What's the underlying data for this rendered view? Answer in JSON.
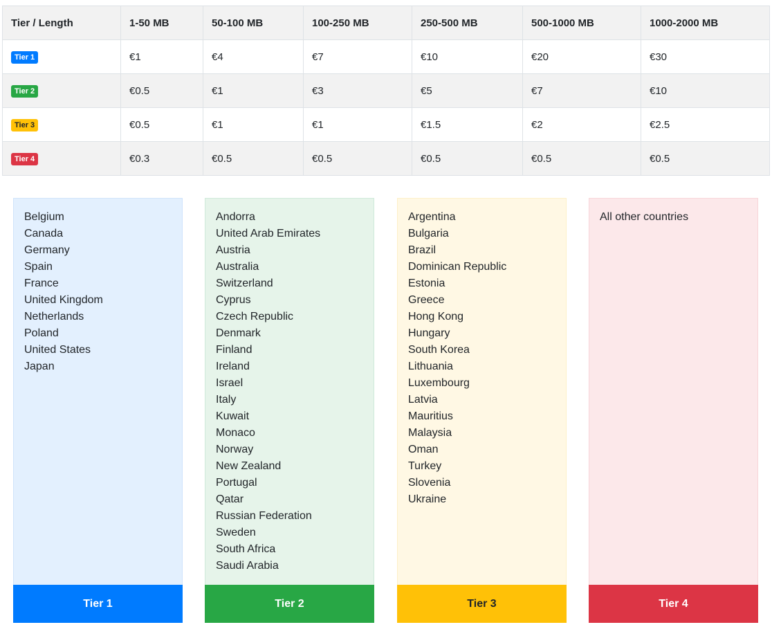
{
  "price_table": {
    "headers": [
      "Tier / Length",
      "1-50 MB",
      "50-100 MB",
      "100-250 MB",
      "250-500 MB",
      "500-1000 MB",
      "1000-2000 MB"
    ],
    "rows": [
      {
        "tier": "Tier 1",
        "prices": [
          "€1",
          "€4",
          "€7",
          "€10",
          "€20",
          "€30"
        ]
      },
      {
        "tier": "Tier 2",
        "prices": [
          "€0.5",
          "€1",
          "€3",
          "€5",
          "€7",
          "€10"
        ]
      },
      {
        "tier": "Tier 3",
        "prices": [
          "€0.5",
          "€1",
          "€1",
          "€1.5",
          "€2",
          "€2.5"
        ]
      },
      {
        "tier": "Tier 4",
        "prices": [
          "€0.3",
          "€0.5",
          "€0.5",
          "€0.5",
          "€0.5",
          "€0.5"
        ]
      }
    ]
  },
  "tier_colors": {
    "tier1": "#007bff",
    "tier2": "#28a745",
    "tier3": "#ffc107",
    "tier4": "#dc3545"
  },
  "tier_cards": [
    {
      "label": "Tier 1",
      "countries": [
        "Belgium",
        "Canada",
        "Germany",
        "Spain",
        "France",
        "United Kingdom",
        "Netherlands",
        "Poland",
        "United States",
        "Japan"
      ]
    },
    {
      "label": "Tier 2",
      "countries": [
        "Andorra",
        "United Arab Emirates",
        "Austria",
        "Australia",
        "Switzerland",
        "Cyprus",
        "Czech Republic",
        "Denmark",
        "Finland",
        "Ireland",
        "Israel",
        "Italy",
        "Kuwait",
        "Monaco",
        "Norway",
        "New Zealand",
        "Portugal",
        "Qatar",
        "Russian Federation",
        "Sweden",
        "South Africa",
        "Saudi Arabia"
      ]
    },
    {
      "label": "Tier 3",
      "countries": [
        "Argentina",
        "Bulgaria",
        "Brazil",
        "Dominican Republic",
        "Estonia",
        "Greece",
        "Hong Kong",
        "Hungary",
        "South Korea",
        "Lithuania",
        "Luxembourg",
        "Latvia",
        "Mauritius",
        "Malaysia",
        "Oman",
        "Turkey",
        "Slovenia",
        "Ukraine"
      ]
    },
    {
      "label": "Tier 4",
      "countries": [
        "All other countries"
      ]
    }
  ]
}
